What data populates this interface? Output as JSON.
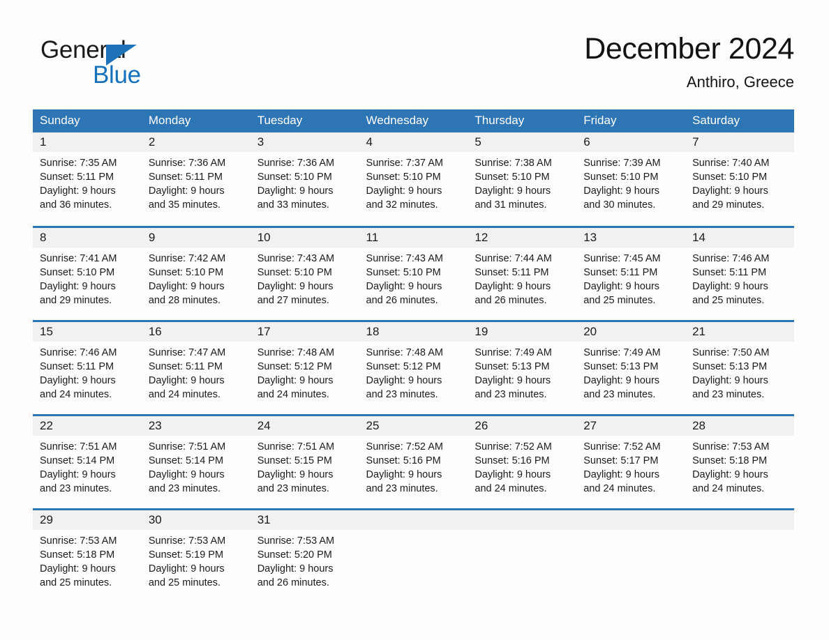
{
  "brand": {
    "word1": "General",
    "word2": "Blue",
    "triangle_icon": "brand-triangle-icon",
    "blue": "#1471bb"
  },
  "header": {
    "title": "December 2024",
    "location": "Anthiro, Greece",
    "accent_color": "#2e75b6",
    "daynum_band_color": "#f1f1f1"
  },
  "weekday_headers": [
    "Sunday",
    "Monday",
    "Tuesday",
    "Wednesday",
    "Thursday",
    "Friday",
    "Saturday"
  ],
  "weeks": [
    {
      "days": [
        {
          "day": "1",
          "sunrise": "Sunrise: 7:35 AM",
          "sunset": "Sunset: 5:11 PM",
          "daylight_l1": "Daylight: 9 hours",
          "daylight_l2": "and 36 minutes."
        },
        {
          "day": "2",
          "sunrise": "Sunrise: 7:36 AM",
          "sunset": "Sunset: 5:11 PM",
          "daylight_l1": "Daylight: 9 hours",
          "daylight_l2": "and 35 minutes."
        },
        {
          "day": "3",
          "sunrise": "Sunrise: 7:36 AM",
          "sunset": "Sunset: 5:10 PM",
          "daylight_l1": "Daylight: 9 hours",
          "daylight_l2": "and 33 minutes."
        },
        {
          "day": "4",
          "sunrise": "Sunrise: 7:37 AM",
          "sunset": "Sunset: 5:10 PM",
          "daylight_l1": "Daylight: 9 hours",
          "daylight_l2": "and 32 minutes."
        },
        {
          "day": "5",
          "sunrise": "Sunrise: 7:38 AM",
          "sunset": "Sunset: 5:10 PM",
          "daylight_l1": "Daylight: 9 hours",
          "daylight_l2": "and 31 minutes."
        },
        {
          "day": "6",
          "sunrise": "Sunrise: 7:39 AM",
          "sunset": "Sunset: 5:10 PM",
          "daylight_l1": "Daylight: 9 hours",
          "daylight_l2": "and 30 minutes."
        },
        {
          "day": "7",
          "sunrise": "Sunrise: 7:40 AM",
          "sunset": "Sunset: 5:10 PM",
          "daylight_l1": "Daylight: 9 hours",
          "daylight_l2": "and 29 minutes."
        }
      ]
    },
    {
      "days": [
        {
          "day": "8",
          "sunrise": "Sunrise: 7:41 AM",
          "sunset": "Sunset: 5:10 PM",
          "daylight_l1": "Daylight: 9 hours",
          "daylight_l2": "and 29 minutes."
        },
        {
          "day": "9",
          "sunrise": "Sunrise: 7:42 AM",
          "sunset": "Sunset: 5:10 PM",
          "daylight_l1": "Daylight: 9 hours",
          "daylight_l2": "and 28 minutes."
        },
        {
          "day": "10",
          "sunrise": "Sunrise: 7:43 AM",
          "sunset": "Sunset: 5:10 PM",
          "daylight_l1": "Daylight: 9 hours",
          "daylight_l2": "and 27 minutes."
        },
        {
          "day": "11",
          "sunrise": "Sunrise: 7:43 AM",
          "sunset": "Sunset: 5:10 PM",
          "daylight_l1": "Daylight: 9 hours",
          "daylight_l2": "and 26 minutes."
        },
        {
          "day": "12",
          "sunrise": "Sunrise: 7:44 AM",
          "sunset": "Sunset: 5:11 PM",
          "daylight_l1": "Daylight: 9 hours",
          "daylight_l2": "and 26 minutes."
        },
        {
          "day": "13",
          "sunrise": "Sunrise: 7:45 AM",
          "sunset": "Sunset: 5:11 PM",
          "daylight_l1": "Daylight: 9 hours",
          "daylight_l2": "and 25 minutes."
        },
        {
          "day": "14",
          "sunrise": "Sunrise: 7:46 AM",
          "sunset": "Sunset: 5:11 PM",
          "daylight_l1": "Daylight: 9 hours",
          "daylight_l2": "and 25 minutes."
        }
      ]
    },
    {
      "days": [
        {
          "day": "15",
          "sunrise": "Sunrise: 7:46 AM",
          "sunset": "Sunset: 5:11 PM",
          "daylight_l1": "Daylight: 9 hours",
          "daylight_l2": "and 24 minutes."
        },
        {
          "day": "16",
          "sunrise": "Sunrise: 7:47 AM",
          "sunset": "Sunset: 5:11 PM",
          "daylight_l1": "Daylight: 9 hours",
          "daylight_l2": "and 24 minutes."
        },
        {
          "day": "17",
          "sunrise": "Sunrise: 7:48 AM",
          "sunset": "Sunset: 5:12 PM",
          "daylight_l1": "Daylight: 9 hours",
          "daylight_l2": "and 24 minutes."
        },
        {
          "day": "18",
          "sunrise": "Sunrise: 7:48 AM",
          "sunset": "Sunset: 5:12 PM",
          "daylight_l1": "Daylight: 9 hours",
          "daylight_l2": "and 23 minutes."
        },
        {
          "day": "19",
          "sunrise": "Sunrise: 7:49 AM",
          "sunset": "Sunset: 5:13 PM",
          "daylight_l1": "Daylight: 9 hours",
          "daylight_l2": "and 23 minutes."
        },
        {
          "day": "20",
          "sunrise": "Sunrise: 7:49 AM",
          "sunset": "Sunset: 5:13 PM",
          "daylight_l1": "Daylight: 9 hours",
          "daylight_l2": "and 23 minutes."
        },
        {
          "day": "21",
          "sunrise": "Sunrise: 7:50 AM",
          "sunset": "Sunset: 5:13 PM",
          "daylight_l1": "Daylight: 9 hours",
          "daylight_l2": "and 23 minutes."
        }
      ]
    },
    {
      "days": [
        {
          "day": "22",
          "sunrise": "Sunrise: 7:51 AM",
          "sunset": "Sunset: 5:14 PM",
          "daylight_l1": "Daylight: 9 hours",
          "daylight_l2": "and 23 minutes."
        },
        {
          "day": "23",
          "sunrise": "Sunrise: 7:51 AM",
          "sunset": "Sunset: 5:14 PM",
          "daylight_l1": "Daylight: 9 hours",
          "daylight_l2": "and 23 minutes."
        },
        {
          "day": "24",
          "sunrise": "Sunrise: 7:51 AM",
          "sunset": "Sunset: 5:15 PM",
          "daylight_l1": "Daylight: 9 hours",
          "daylight_l2": "and 23 minutes."
        },
        {
          "day": "25",
          "sunrise": "Sunrise: 7:52 AM",
          "sunset": "Sunset: 5:16 PM",
          "daylight_l1": "Daylight: 9 hours",
          "daylight_l2": "and 23 minutes."
        },
        {
          "day": "26",
          "sunrise": "Sunrise: 7:52 AM",
          "sunset": "Sunset: 5:16 PM",
          "daylight_l1": "Daylight: 9 hours",
          "daylight_l2": "and 24 minutes."
        },
        {
          "day": "27",
          "sunrise": "Sunrise: 7:52 AM",
          "sunset": "Sunset: 5:17 PM",
          "daylight_l1": "Daylight: 9 hours",
          "daylight_l2": "and 24 minutes."
        },
        {
          "day": "28",
          "sunrise": "Sunrise: 7:53 AM",
          "sunset": "Sunset: 5:18 PM",
          "daylight_l1": "Daylight: 9 hours",
          "daylight_l2": "and 24 minutes."
        }
      ]
    },
    {
      "days": [
        {
          "day": "29",
          "sunrise": "Sunrise: 7:53 AM",
          "sunset": "Sunset: 5:18 PM",
          "daylight_l1": "Daylight: 9 hours",
          "daylight_l2": "and 25 minutes."
        },
        {
          "day": "30",
          "sunrise": "Sunrise: 7:53 AM",
          "sunset": "Sunset: 5:19 PM",
          "daylight_l1": "Daylight: 9 hours",
          "daylight_l2": "and 25 minutes."
        },
        {
          "day": "31",
          "sunrise": "Sunrise: 7:53 AM",
          "sunset": "Sunset: 5:20 PM",
          "daylight_l1": "Daylight: 9 hours",
          "daylight_l2": "and 26 minutes."
        },
        {
          "day": "",
          "sunrise": "",
          "sunset": "",
          "daylight_l1": "",
          "daylight_l2": ""
        },
        {
          "day": "",
          "sunrise": "",
          "sunset": "",
          "daylight_l1": "",
          "daylight_l2": ""
        },
        {
          "day": "",
          "sunrise": "",
          "sunset": "",
          "daylight_l1": "",
          "daylight_l2": ""
        },
        {
          "day": "",
          "sunrise": "",
          "sunset": "",
          "daylight_l1": "",
          "daylight_l2": ""
        }
      ]
    }
  ]
}
